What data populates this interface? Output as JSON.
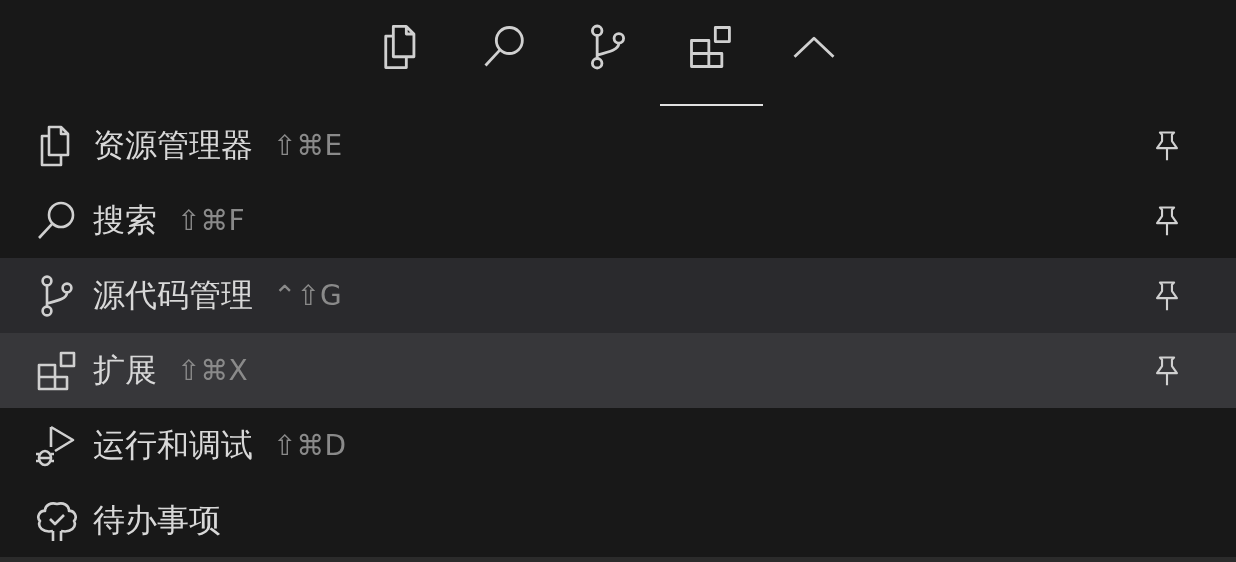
{
  "activity_tabs": [
    {
      "kind": "explorer",
      "selected": false
    },
    {
      "kind": "search",
      "selected": false
    },
    {
      "kind": "scm",
      "selected": false
    },
    {
      "kind": "extensions",
      "selected": true
    }
  ],
  "overflow_toggle": {
    "kind": "chevron"
  },
  "views": [
    {
      "kind": "explorer",
      "label": "资源管理器",
      "shortcut": "⇧⌘E",
      "pinned": true,
      "hovered": false,
      "selected": false
    },
    {
      "kind": "search",
      "label": "搜索",
      "shortcut": "⇧⌘F",
      "pinned": true,
      "hovered": false,
      "selected": false
    },
    {
      "kind": "scm",
      "label": "源代码管理",
      "shortcut": "⌃⇧G",
      "pinned": true,
      "hovered": true,
      "selected": false
    },
    {
      "kind": "extensions",
      "label": "扩展",
      "shortcut": "⇧⌘X",
      "pinned": true,
      "hovered": false,
      "selected": true
    },
    {
      "kind": "debug",
      "label": "运行和调试",
      "shortcut": "⇧⌘D",
      "pinned": false,
      "hovered": false,
      "selected": false
    },
    {
      "kind": "todo",
      "label": "待办事项",
      "pinned": false,
      "hovered": false,
      "selected": false
    }
  ]
}
